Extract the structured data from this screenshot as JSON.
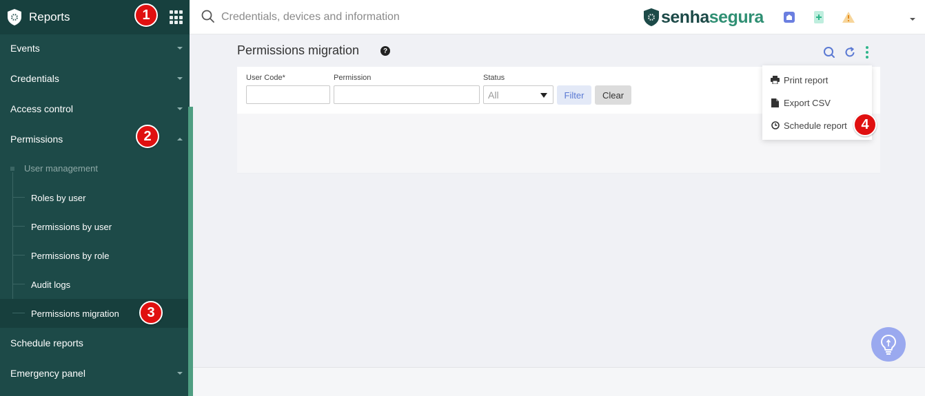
{
  "app": {
    "title": "Reports"
  },
  "search": {
    "placeholder": "Credentials, devices and information"
  },
  "brand": {
    "part1": "senha",
    "part2": "segura"
  },
  "sidebar": {
    "items": [
      {
        "label": "Events"
      },
      {
        "label": "Credentials"
      },
      {
        "label": "Access control"
      },
      {
        "label": "Permissions"
      },
      {
        "label": "Schedule reports"
      },
      {
        "label": "Emergency panel"
      }
    ],
    "group_label": "User management",
    "sub_items": [
      {
        "label": "Roles by user"
      },
      {
        "label": "Permissions by user"
      },
      {
        "label": "Permissions by role"
      },
      {
        "label": "Audit logs"
      },
      {
        "label": "Permissions migration"
      }
    ]
  },
  "page": {
    "title": "Permissions migration",
    "help": "?"
  },
  "filters": {
    "user_code_label": "User Code*",
    "user_code_value": "",
    "permission_label": "Permission",
    "permission_value": "",
    "status_label": "Status",
    "status_value": "All",
    "filter_button": "Filter",
    "clear_button": "Clear"
  },
  "menu": {
    "print": "Print report",
    "export": "Export CSV",
    "schedule": "Schedule report"
  },
  "badges": {
    "b1": "1",
    "b2": "2",
    "b3": "3",
    "b4": "4"
  },
  "colors": {
    "sidebar_bg": "#1d4a48",
    "accent_green": "#2f8f73",
    "badge_red": "#e01010",
    "home_icon": "#6b7fe0",
    "plus_icon": "#3cc7a0",
    "warning_icon": "#f0b44a"
  }
}
